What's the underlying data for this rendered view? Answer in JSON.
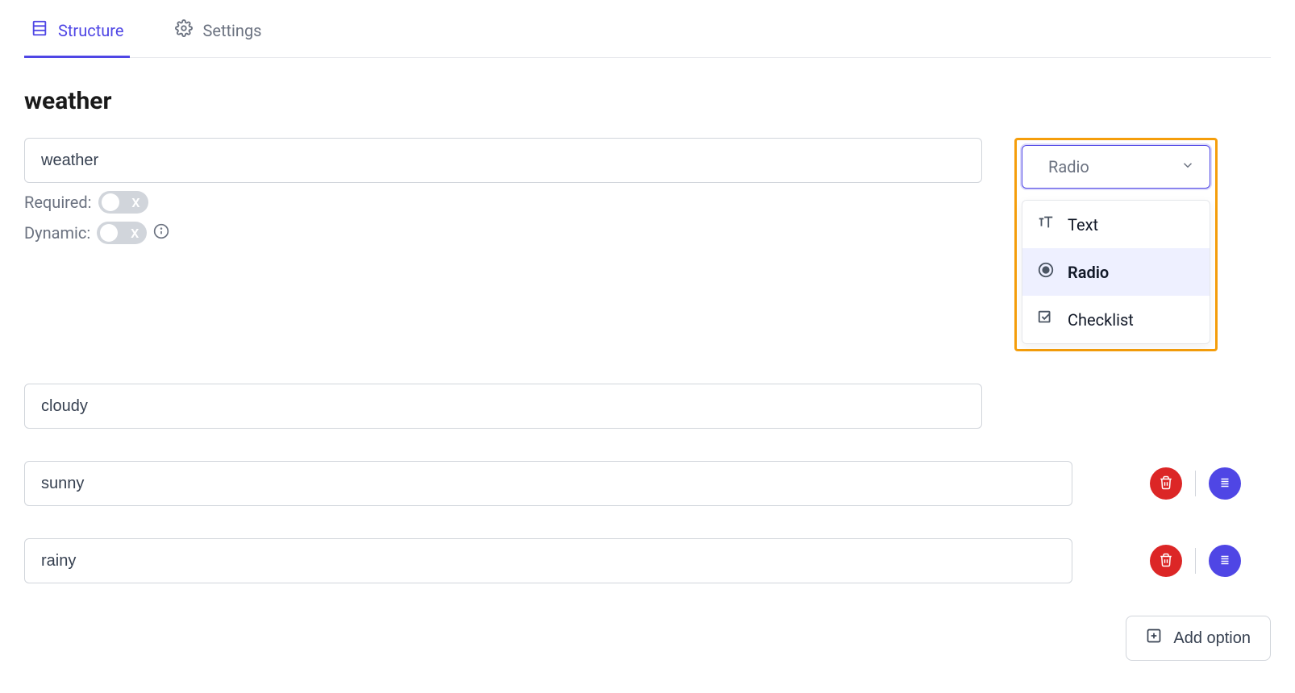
{
  "tabs": {
    "structure": "Structure",
    "settings": "Settings",
    "active": "structure"
  },
  "title": "weather",
  "question_name_input": "weather",
  "toggles": {
    "required_label": "Required:",
    "required_value": false,
    "dynamic_label": "Dynamic:",
    "dynamic_value": false
  },
  "type_select": {
    "selected": "Radio",
    "options": [
      {
        "label": "Text",
        "icon": "text"
      },
      {
        "label": "Radio",
        "icon": "radio"
      },
      {
        "label": "Checklist",
        "icon": "checklist"
      }
    ]
  },
  "options": [
    {
      "value": "cloudy",
      "has_controls": false
    },
    {
      "value": "sunny",
      "has_controls": true
    },
    {
      "value": "rainy",
      "has_controls": true
    }
  ],
  "add_option_label": "Add option"
}
